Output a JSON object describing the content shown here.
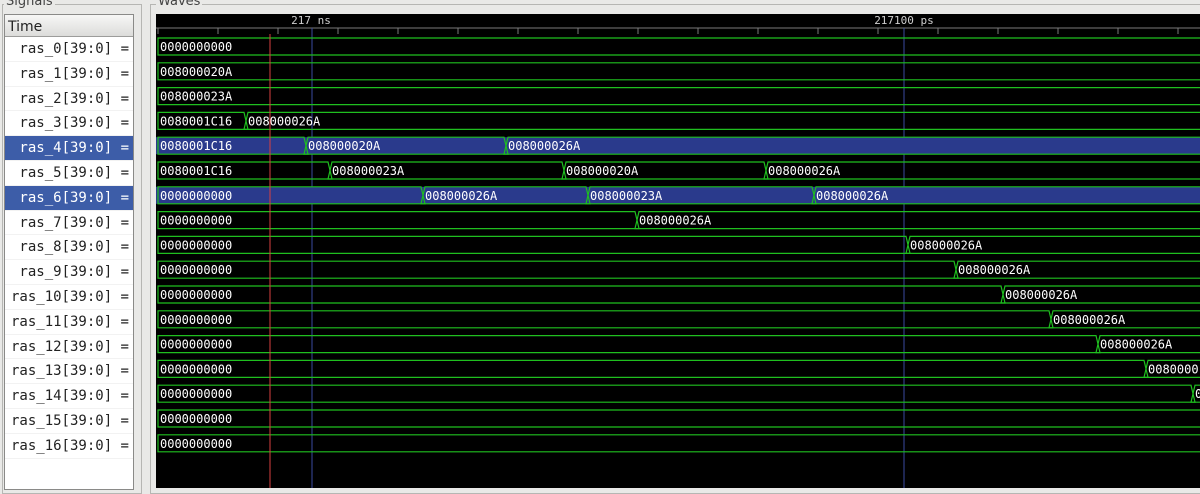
{
  "signals_pane": {
    "title": "Signals",
    "header": "Time",
    "signals": [
      {
        "label": "ras_0[39:0] =",
        "selected": false
      },
      {
        "label": "ras_1[39:0] =",
        "selected": false
      },
      {
        "label": "ras_2[39:0] =",
        "selected": false
      },
      {
        "label": "ras_3[39:0] =",
        "selected": false
      },
      {
        "label": "ras_4[39:0] =",
        "selected": true
      },
      {
        "label": "ras_5[39:0] =",
        "selected": false
      },
      {
        "label": "ras_6[39:0] =",
        "selected": true
      },
      {
        "label": "ras_7[39:0] =",
        "selected": false
      },
      {
        "label": "ras_8[39:0] =",
        "selected": false
      },
      {
        "label": "ras_9[39:0] =",
        "selected": false
      },
      {
        "label": "ras_10[39:0] =",
        "selected": false
      },
      {
        "label": "ras_11[39:0] =",
        "selected": false
      },
      {
        "label": "ras_12[39:0] =",
        "selected": false
      },
      {
        "label": "ras_13[39:0] =",
        "selected": false
      },
      {
        "label": "ras_14[39:0] =",
        "selected": false
      },
      {
        "label": "ras_15[39:0] =",
        "selected": false
      },
      {
        "label": "ras_16[39:0] =",
        "selected": false
      }
    ]
  },
  "waves_pane": {
    "title": "Waves",
    "time_labels": [
      "217 ns",
      "217100 ps"
    ],
    "colors": {
      "background": "#000000",
      "trace": "#1fbf1f",
      "text": "#ffffff",
      "highlight": "#2a3a8c",
      "cursor": "#d84040",
      "marker": "#3a4aa0",
      "tick": "#7a7a7a"
    },
    "traces": [
      {
        "segments": [
          {
            "value": "0000000000"
          }
        ]
      },
      {
        "segments": [
          {
            "value": "008000020A"
          }
        ]
      },
      {
        "segments": [
          {
            "value": "008000023A"
          }
        ]
      },
      {
        "segments": [
          {
            "value": "0080001C16"
          },
          {
            "value": "008000026A"
          }
        ]
      },
      {
        "segments": [
          {
            "value": "0080001C16"
          },
          {
            "value": "008000020A"
          },
          {
            "value": "008000026A"
          }
        ]
      },
      {
        "segments": [
          {
            "value": "0080001C16"
          },
          {
            "value": "008000023A"
          },
          {
            "value": "008000020A"
          },
          {
            "value": "008000026A"
          }
        ]
      },
      {
        "segments": [
          {
            "value": "0000000000"
          },
          {
            "value": "008000026A"
          },
          {
            "value": "008000023A"
          },
          {
            "value": "008000026A"
          }
        ]
      },
      {
        "segments": [
          {
            "value": "0000000000"
          },
          {
            "value": "008000026A"
          }
        ]
      },
      {
        "segments": [
          {
            "value": "0000000000"
          },
          {
            "value": "008000026A"
          }
        ]
      },
      {
        "segments": [
          {
            "value": "0000000000"
          },
          {
            "value": "008000026A"
          }
        ]
      },
      {
        "segments": [
          {
            "value": "0000000000"
          },
          {
            "value": "008000026A"
          }
        ]
      },
      {
        "segments": [
          {
            "value": "0000000000"
          },
          {
            "value": "008000026A"
          }
        ]
      },
      {
        "segments": [
          {
            "value": "0000000000"
          },
          {
            "value": "008000026A"
          }
        ]
      },
      {
        "segments": [
          {
            "value": "0000000000"
          },
          {
            "value": "0080000"
          }
        ]
      },
      {
        "segments": [
          {
            "value": "0000000000"
          },
          {
            "value": "0"
          }
        ]
      },
      {
        "segments": [
          {
            "value": "0000000000"
          }
        ]
      },
      {
        "segments": [
          {
            "value": "0000000000"
          }
        ]
      }
    ]
  }
}
